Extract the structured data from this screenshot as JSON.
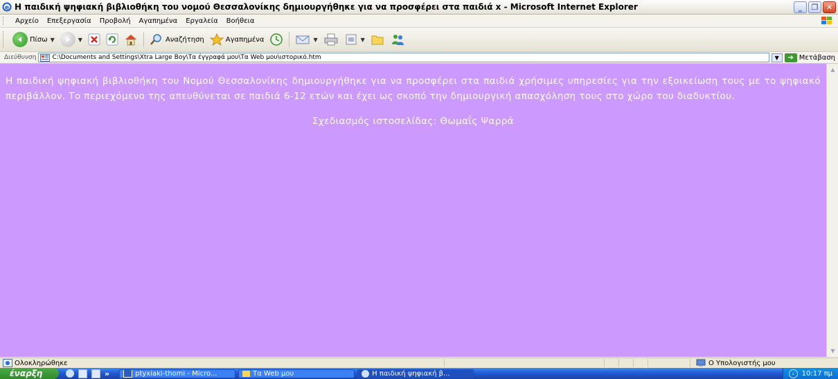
{
  "window": {
    "title": "Η παιδική ψηφιακή βιβλιοθήκη του νομού Θεσσαλονίκης δημιουργήθηκε για να προσφέρει στα παιδιά x - Microsoft Internet Explorer"
  },
  "menu": [
    "Αρχείο",
    "Επεξεργασία",
    "Προβολή",
    "Αγαπημένα",
    "Εργαλεία",
    "Βοήθεια"
  ],
  "toolbar": {
    "back_label": "Πίσω",
    "search_label": "Αναζήτηση",
    "favorites_label": "Αγαπημένα"
  },
  "address": {
    "label": "Διεύθυνση",
    "value": "C:\\Documents and Settings\\Xtra Large Boy\\Τα έγγραφά μου\\Τα Web μου\\ιστορικό.htm",
    "go_label": "Μετάβαση"
  },
  "content": {
    "paragraph": "Η παιδική ψηφιακή βιβλιοθήκη του Νομού Θεσσαλονίκης δημιουργήθηκε για να προσφέρει στα παιδιά χρήσιμες υπηρεσίες για την εξοικείωση τους με το ψηφιακό περιβάλλον. Το περιεχόμενο της απευθύνεται σε παιδιά 6-12 ετών και έχει ως σκοπό την δημιουργική απασχόληση τους στο χώρο του διαδυκτίου.",
    "credit": "Σχεδιασμός ιστοσελίδας: Θωμαΐς Ψαρρά",
    "background_color": "#cc99ff",
    "text_color": "#ffffff"
  },
  "status": {
    "text": "Ολοκληρώθηκε",
    "zone": "Ο Υπολογιστής μου"
  },
  "taskbar": {
    "start_label": "έναρξη",
    "chevron": "»",
    "tasks": [
      "ptyxiaki-thomi - Micro...",
      "Τα Web μου",
      "Η παιδική ψηφιακή β..."
    ],
    "clock": "10:17 πμ"
  }
}
